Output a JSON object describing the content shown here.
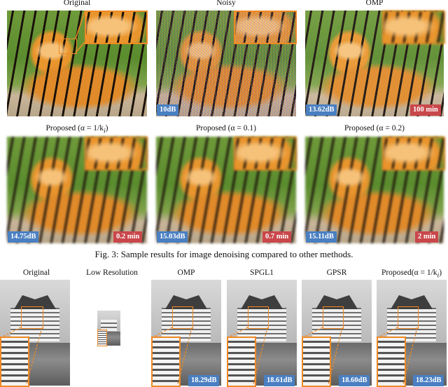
{
  "denoising": {
    "titles": {
      "original": "Original",
      "noisy": "Noisy",
      "omp": "OMP",
      "proposed_a": "Proposed (α = 1/k",
      "proposed_a_sub": "i",
      "proposed_a_end": ")",
      "proposed_b": "Proposed (α = 0.1)",
      "proposed_c": "Proposed (α = 0.2)"
    },
    "badges": {
      "noisy_psnr": "10dB",
      "omp_psnr": "13.62dB",
      "omp_time": "100 min",
      "pa_psnr": "14.75dB",
      "pa_time": "0.2 min",
      "pb_psnr": "15.03dB",
      "pb_time": "0.7 min",
      "pc_psnr": "15.11dB",
      "pc_time": "2 min"
    },
    "caption": "Fig. 3: Sample results for image denoising compared to other methods."
  },
  "superres": {
    "titles": {
      "original": "Original",
      "lowres": "Low Resolution",
      "omp": "OMP",
      "spgl1": "SPGL1",
      "gpsr": "GPSR",
      "proposed": "Proposed(α = 1/k",
      "proposed_sub": "i",
      "proposed_end": ")"
    },
    "badges": {
      "omp": "18.29dB",
      "spgl1": "18.61dB",
      "gpsr": "18.60dB",
      "proposed": "18.23dB"
    }
  },
  "colors": {
    "psnr_badge": "#4a7fc1",
    "time_badge": "#c9474b",
    "zoom_border": "#f08a24"
  }
}
